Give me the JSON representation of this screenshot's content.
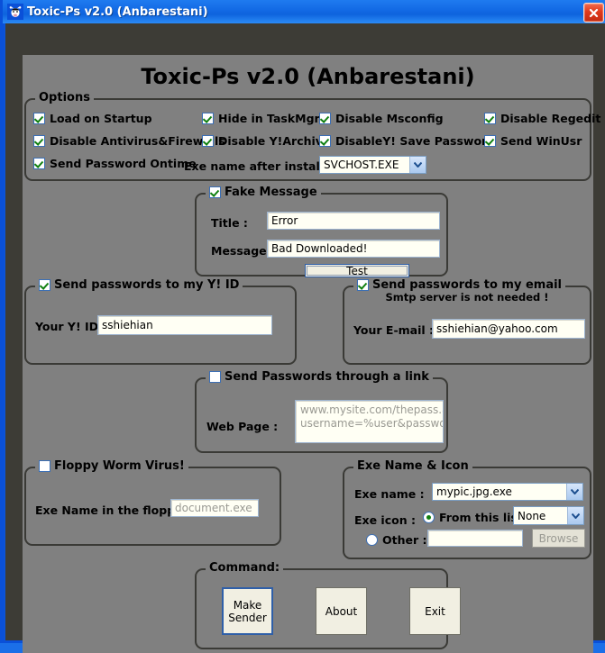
{
  "window": {
    "title": "Toxic-Ps v2.0 (Anbarestani)",
    "icon": "cow-head-icon",
    "close_label": "×",
    "titlebar_color": "#1268e3",
    "client_color": "#808080"
  },
  "headline": "Toxic-Ps v2.0 (Anbarestani)",
  "options": {
    "title": "Options",
    "checkboxes": [
      {
        "label": "Load on Startup",
        "checked": true
      },
      {
        "label": "Hide in TaskMgr",
        "checked": true
      },
      {
        "label": "Disable Msconfig",
        "checked": true
      },
      {
        "label": "Disable Regedit",
        "checked": true
      },
      {
        "label": "Disable Antivirus&Firewalls",
        "checked": true
      },
      {
        "label": "Disable Y!Archive",
        "checked": true
      },
      {
        "label": "DisableY! Save Password",
        "checked": true
      },
      {
        "label": "Send WinUsr",
        "checked": true
      },
      {
        "label": "Send Password Ontime",
        "checked": true
      }
    ],
    "exe_name_label": "Exe name after install :",
    "exe_name_value": "SVCHOST.EXE"
  },
  "fake_message": {
    "title": "Fake Message",
    "checked": true,
    "title_label": "Title :",
    "title_value": "Error",
    "message_label": "Message :",
    "message_value": "Bad Downloaded!",
    "test_button": "Test"
  },
  "yahoo_id": {
    "title": "Send passwords to my Y! ID",
    "checked": true,
    "field_label": "Your Y! ID :",
    "field_value": "sshiehian"
  },
  "email": {
    "title": "Send passwords to my email",
    "subtitle": "Smtp server is not needed !",
    "checked": true,
    "field_label": "Your E-mail :",
    "field_value": "sshiehian@yahoo.com"
  },
  "link": {
    "title": "Send Passwords through a link",
    "checked": false,
    "field_label": "Web Page :",
    "field_placeholder_line1": "www.mysite.com/thepass.asp?",
    "field_placeholder_line2": "username=%user&passwd=%pass"
  },
  "floppy": {
    "title": "Floppy Worm Virus!",
    "checked": false,
    "field_label": "Exe Name in the floppy :",
    "field_placeholder": "document.exe"
  },
  "exe_icon": {
    "title": "Exe Name & Icon",
    "exe_name_label": "Exe name :",
    "exe_name_value": "mypic.jpg.exe",
    "exe_icon_label": "Exe icon :",
    "from_list_label": "From this list :",
    "from_list_selected": true,
    "icon_list_value": "None",
    "other_label": "Other :",
    "other_selected": false,
    "other_value": "",
    "browse_label": "Browse"
  },
  "command": {
    "title": "Command:",
    "make_sender_line1": "Make",
    "make_sender_line2": "Sender",
    "about_label": "About",
    "exit_label": "Exit"
  }
}
